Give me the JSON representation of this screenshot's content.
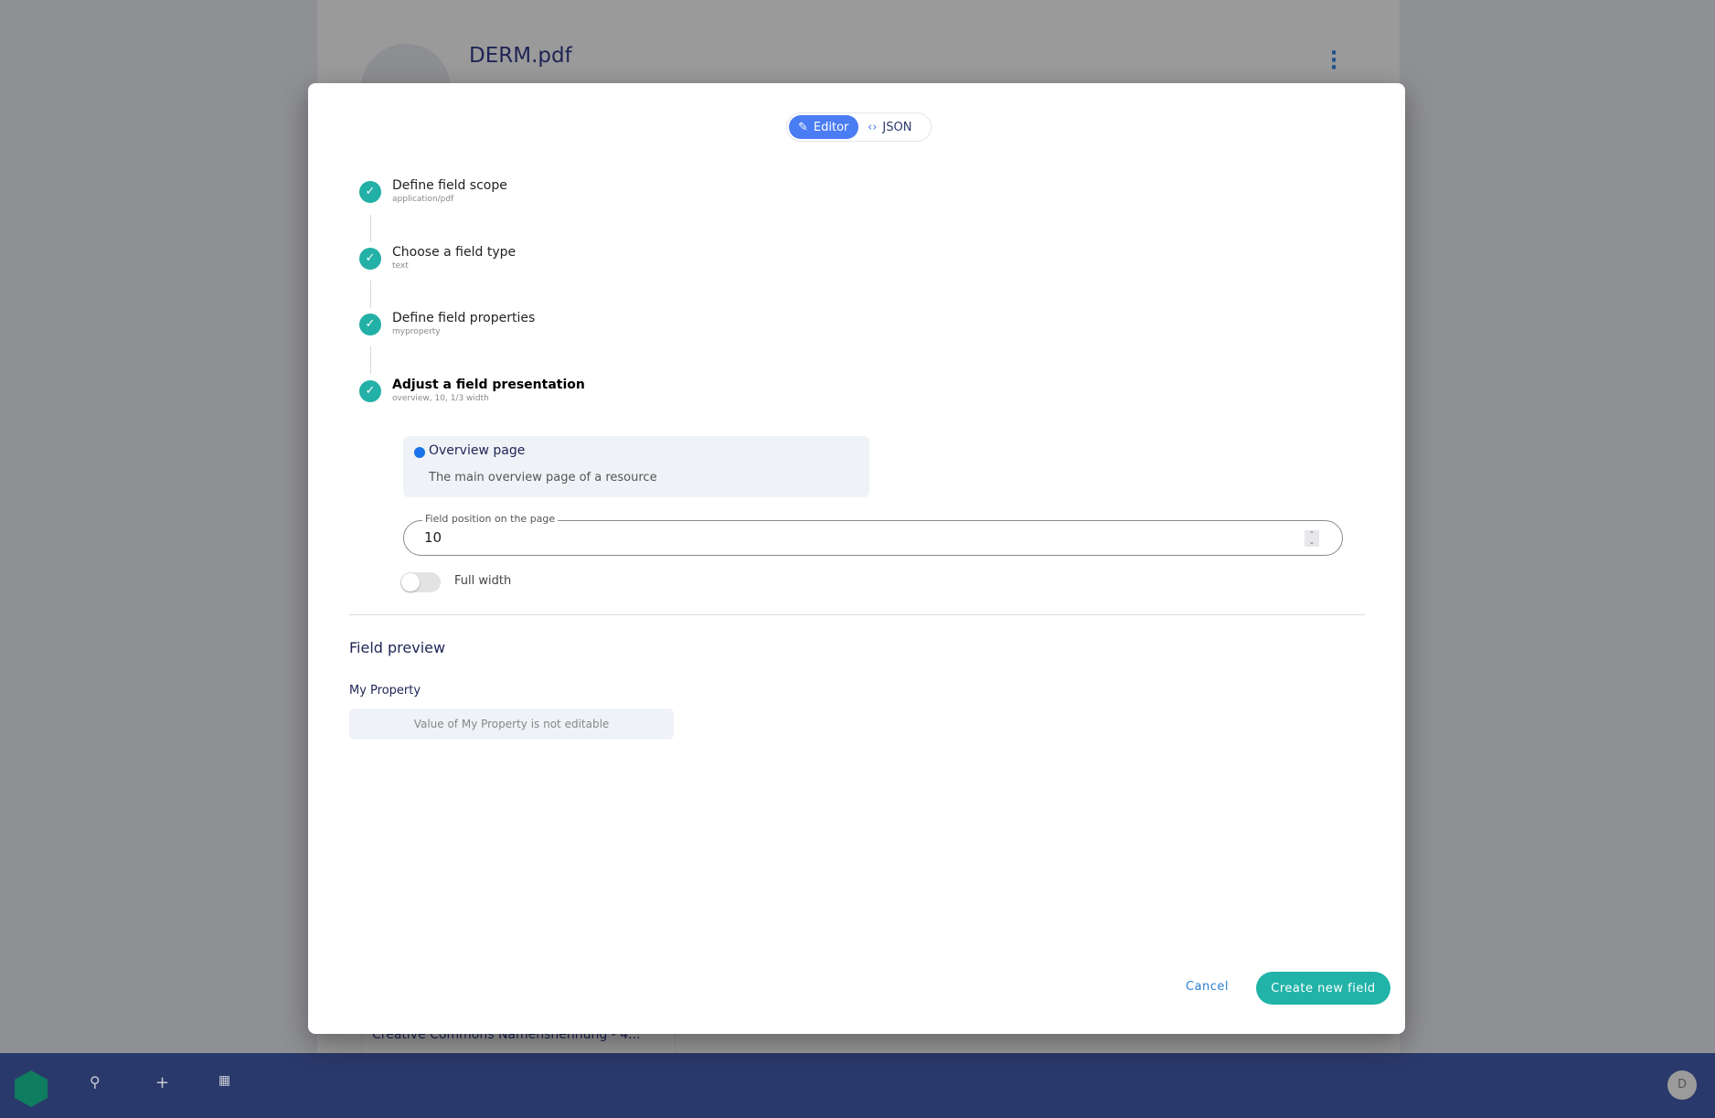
{
  "background": {
    "title": "DERM.pdf",
    "card_text": "Creative Commons Namensnennung - 4...",
    "kebab_icon": "more-vertical-icon"
  },
  "bottom_bar": {
    "icons": [
      "logo-icon",
      "search-icon",
      "plus-icon",
      "dashboard-icon"
    ],
    "avatar_initial": "D",
    "color": "#2a396b"
  },
  "modal": {
    "modes": [
      {
        "label": "Editor",
        "icon": "pencil-icon",
        "active": true
      },
      {
        "label": "JSON",
        "icon": "code-icon",
        "active": false
      }
    ],
    "steps": [
      {
        "title": "Define field scope",
        "subtitle": "application/pdf",
        "done": true
      },
      {
        "title": "Choose a field type",
        "subtitle": "text",
        "done": true
      },
      {
        "title": "Define field properties",
        "subtitle": "myproperty",
        "done": true
      },
      {
        "title": "Adjust a field presentation",
        "subtitle": "overview, 10, 1/3 width",
        "done": true
      }
    ],
    "overview_card": {
      "title": "Overview page",
      "description": "The main overview page of a resource"
    },
    "position_field": {
      "label": "Field position on the page",
      "value": "10"
    },
    "full_width": {
      "label": "Full width",
      "enabled": false
    },
    "preview": {
      "title": "Field preview",
      "property_label": "My Property",
      "property_value": "Value of My Property is not editable"
    },
    "actions": {
      "cancel": "Cancel",
      "create": "Create new field"
    },
    "accent_color": "#21b3a8"
  }
}
